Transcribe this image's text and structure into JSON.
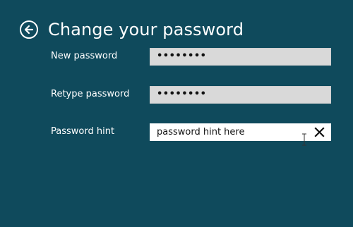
{
  "header": {
    "title": "Change your password",
    "back_icon": "back-arrow-circle-icon"
  },
  "form": {
    "new_password": {
      "label": "New password",
      "value": "••••••••"
    },
    "retype_password": {
      "label": "Retype password",
      "value": "••••••••"
    },
    "password_hint": {
      "label": "Password hint",
      "value": "password hint here",
      "clear_icon": "clear-x-icon"
    }
  },
  "colors": {
    "background": "#0f4a5c",
    "text": "#ffffff",
    "password_field": "#d9d9d9",
    "hint_field": "#ffffff"
  }
}
